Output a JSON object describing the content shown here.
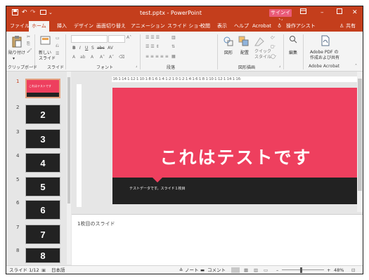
{
  "titlebar": {
    "doc_title": "test.pptx - PowerPoint",
    "signin": "サインイン"
  },
  "tabs": [
    "ファイル",
    "ホーム",
    "挿入",
    "デザイン",
    "画面切り替え",
    "アニメーション",
    "スライド ショー",
    "校閲",
    "表示",
    "ヘルプ",
    "Acrobat"
  ],
  "active_tab": "ホーム",
  "tell_me": "操作アシスト",
  "share": "共有",
  "ribbon": {
    "paste": "貼り付け",
    "new_slide": "新しい\nスライド",
    "shapes": "図形",
    "arrange": "配置",
    "quick_styles": "クイック\nスタイル",
    "edit": "編集",
    "adobe_pdf": "Adobe PDF の\n作成および共有",
    "groups": [
      "クリップボード",
      "スライド",
      "フォント",
      "段落",
      "図形描画",
      "Adobe Acrobat"
    ]
  },
  "ruler_text": "·16·1·14·1·12·1·10·1·8·1·6·1·4·1·2·1·0·1·2·1·4·1·6·1·8·1·10·1·12·1·14·1·16·",
  "thumbnails": [
    {
      "num": "1",
      "label": "これはテストです"
    },
    {
      "num": "2",
      "label": "2"
    },
    {
      "num": "3",
      "label": "3"
    },
    {
      "num": "4",
      "label": "4"
    },
    {
      "num": "5",
      "label": "5"
    },
    {
      "num": "6",
      "label": "6"
    },
    {
      "num": "7",
      "label": "7"
    },
    {
      "num": "8",
      "label": "8"
    }
  ],
  "slide": {
    "title": "これはテストです",
    "subtitle": "テストデータです。スライド１枚目"
  },
  "notes": "1枚目のスライド",
  "status": {
    "slide_count": "スライド 1/12",
    "language": "日本語",
    "notes_btn": "ノート",
    "comments_btn": "コメント",
    "zoom": "48%"
  },
  "colors": {
    "accent": "#c43e1c",
    "slide_bg": "#ee3f5e",
    "slide_band": "#222222"
  }
}
